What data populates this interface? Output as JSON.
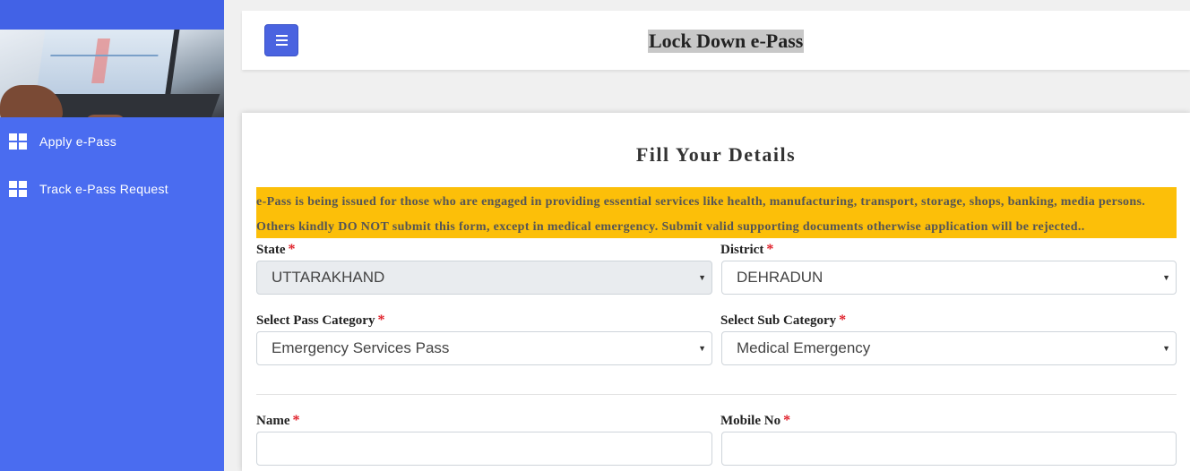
{
  "app": {
    "title": "Lock Down e-Pass"
  },
  "sidebar": {
    "items": [
      {
        "label": "Apply e-Pass",
        "icon": "grid-icon"
      },
      {
        "label": "Track e-Pass Request",
        "icon": "grid-icon"
      }
    ]
  },
  "form": {
    "title": "Fill Your Details",
    "notice_line1": "e-Pass is being issued for those who are engaged in providing essential services like health, manufacturing, transport, storage, shops, banking, media persons.",
    "notice_line2": "Others kindly DO NOT submit this form, except in medical emergency. Submit valid supporting documents otherwise application will be rejected..",
    "required_mark": "*",
    "state": {
      "label": "State",
      "value": "UTTARAKHAND"
    },
    "district": {
      "label": "District",
      "value": "DEHRADUN"
    },
    "pass_category": {
      "label": "Select Pass Category",
      "value": "Emergency Services Pass"
    },
    "sub_category": {
      "label": "Select Sub Category",
      "value": "Medical Emergency"
    },
    "name": {
      "label": "Name",
      "value": ""
    },
    "mobile": {
      "label": "Mobile No",
      "value": ""
    }
  },
  "colors": {
    "sidebar": "#4a6cf0",
    "notice": "#fcbf09",
    "menu_button": "#4a63e0",
    "required": "#e0202a"
  }
}
